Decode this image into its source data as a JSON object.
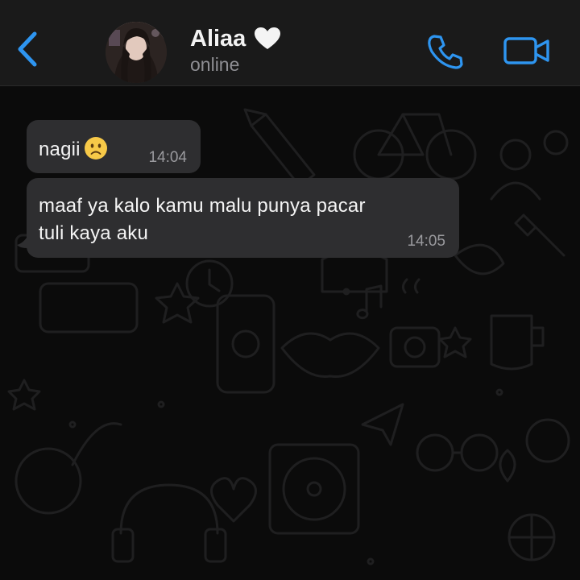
{
  "header": {
    "contact_name": "Aliaa",
    "status": "online",
    "accent_color": "#2e95f0"
  },
  "icons": {
    "back": "chevron-left-icon",
    "heart": "white-heart-icon",
    "call": "phone-icon",
    "video": "video-camera-icon",
    "emoji": "slightly-frowning-face-icon"
  },
  "messages": [
    {
      "text": "nagii",
      "emoji": "slightly-frowning-face",
      "time": "14:04"
    },
    {
      "line1": "maaf ya kalo kamu malu punya pacar",
      "line2": "tuli kaya aku",
      "time": "14:05"
    }
  ]
}
